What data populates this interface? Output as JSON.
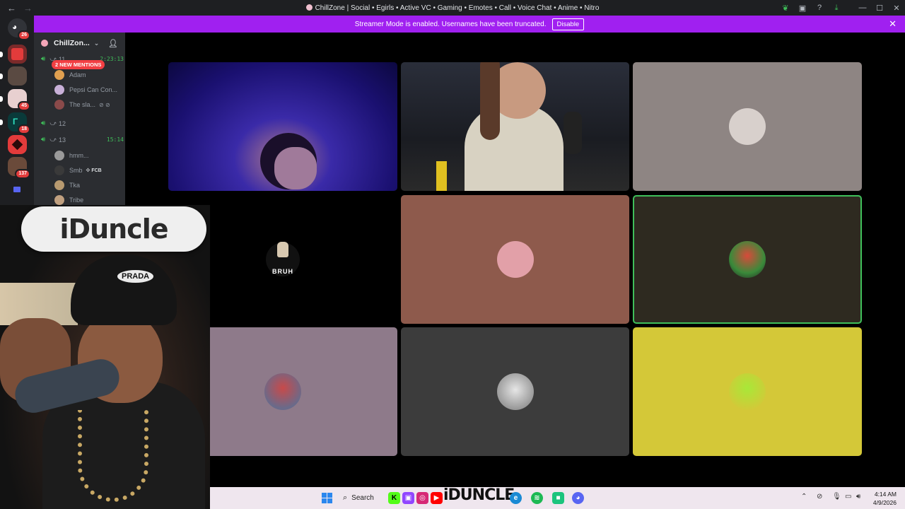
{
  "window": {
    "title": "ChillZone | Social • Egirls • Active VC • Gaming • Emotes • Call • Voice Chat • Anime • Nitro"
  },
  "banner": {
    "text": "Streamer Mode is enabled. Usernames have been truncated.",
    "button": "Disable"
  },
  "rail": {
    "servers": [
      {
        "name": "discord-home",
        "badge": "26",
        "color": "#313338"
      },
      {
        "name": "server-red-logo",
        "badge": "",
        "color": "#7a2a2a"
      },
      {
        "name": "server-portrait",
        "badge": "",
        "color": "#5a4a42"
      },
      {
        "name": "server-anime-girl",
        "badge": "45",
        "color": "#e8d0d0"
      },
      {
        "name": "server-teal",
        "badge": "18",
        "color": "#0a3a3a"
      },
      {
        "name": "server-red-square",
        "badge": "",
        "color": "#e33b3b"
      },
      {
        "name": "server-group",
        "badge": "137",
        "color": "#6a4a3a"
      }
    ]
  },
  "sidebar": {
    "guild_name": "ChillZon...",
    "mentions_pill": "2 NEW MENTIONS",
    "channels": [
      {
        "name": "11",
        "time": "2:23:13"
      },
      {
        "name": "12",
        "time": ""
      },
      {
        "name": "13",
        "time": "15:14"
      }
    ],
    "members": [
      {
        "name": "Adam",
        "tag": "",
        "icons": "",
        "color": "#e0a050"
      },
      {
        "name": "Pepsi Can Con...",
        "tag": "",
        "icons": "",
        "color": "#c8b0d8"
      },
      {
        "name": "The sla...",
        "tag": "",
        "icons": "⊘ ⊘",
        "color": "#8a4a4a"
      },
      {
        "name": "hmm...",
        "tag": "",
        "icons": "",
        "color": "#9a9a9a"
      },
      {
        "name": "Smb",
        "tag": "✣ FCB",
        "icons": "",
        "color": "#3a3a3a"
      },
      {
        "name": "Tka",
        "tag": "",
        "icons": "",
        "color": "#b89a70"
      },
      {
        "name": "Tribe",
        "tag": "",
        "icons": "",
        "color": "#c0a080"
      }
    ]
  },
  "tiles": [
    {
      "name": "tile-video-blue",
      "bg": "#2a1a8a"
    },
    {
      "name": "tile-video-guy",
      "bg": "#3a3a3a"
    },
    {
      "name": "tile-avatar-grey",
      "bg": "#8e8583",
      "avatar": "#d8d0cc"
    },
    {
      "name": "tile-bruh",
      "bg": "#000000",
      "avatar": "#111111",
      "label": "BRUH"
    },
    {
      "name": "tile-chopper",
      "bg": "#8e5a4c",
      "avatar": "#e2a0a8"
    },
    {
      "name": "tile-mario",
      "bg": "#2e2a20",
      "avatar": "#b83a2a",
      "speaking": true
    },
    {
      "name": "tile-mauve",
      "bg": "#8e7a8a",
      "avatar": "#c84a4a"
    },
    {
      "name": "tile-dog",
      "bg": "#3c3c3c",
      "avatar": "#cfcfcf"
    },
    {
      "name": "tile-yellow",
      "bg": "#d4c838",
      "avatar": "#a8d838"
    }
  ],
  "webcam": {
    "board_text": "iDuncle",
    "hat_text": "PRADA"
  },
  "taskbar": {
    "search": "Search",
    "brand": "iDUNCLE",
    "time": "4:14 AM",
    "date": "4/9/2026"
  }
}
